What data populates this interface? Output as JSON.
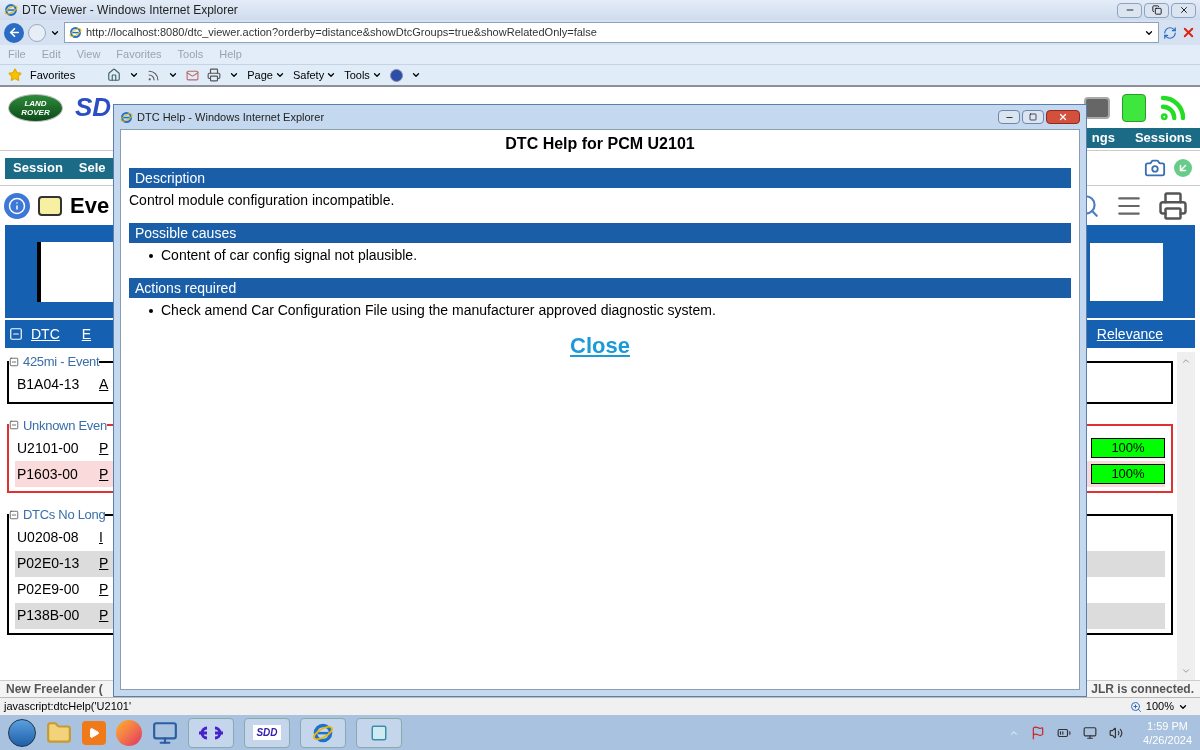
{
  "browser": {
    "title": "DTC Viewer - Windows Internet Explorer",
    "address": "http://localhost:8080/dtc_viewer.action?orderby=distance&showDtcGroups=true&showRelatedOnly=false",
    "menu": [
      "File",
      "Edit",
      "View",
      "Favorites",
      "Tools",
      "Help"
    ],
    "favorites": "Favorites",
    "commands": [
      "Page",
      "Safety",
      "Tools"
    ],
    "status_text": "javascript:dtcHelp('U2101'",
    "zoom": "100%"
  },
  "app": {
    "logo": [
      "LAND",
      "ROVER"
    ],
    "brand": "SD",
    "nav_left": [
      "Session",
      "Sele"
    ],
    "nav_right": [
      "ngs",
      "Sessions"
    ],
    "page_title": "Eve",
    "columns_left": [
      "DTC",
      "E"
    ],
    "column_right": "Relevance",
    "groups": [
      {
        "title": "425mi - Event",
        "alert": false,
        "rows": [
          {
            "code": "B1A04-13",
            "col2": "A",
            "kind": "plain"
          }
        ]
      },
      {
        "title": "Unknown Even",
        "alert": true,
        "rows": [
          {
            "code": "U2101-00",
            "col2": "P",
            "kind": "plain",
            "relevance": "100%"
          },
          {
            "code": "P1603-00",
            "col2": "P",
            "kind": "pink",
            "relevance": "100%"
          }
        ]
      },
      {
        "title": "DTCs No Long",
        "alert": false,
        "rows": [
          {
            "code": "U0208-08",
            "col2": "I",
            "kind": "plain"
          },
          {
            "code": "P02E0-13",
            "col2": "P",
            "kind": "grey"
          },
          {
            "code": "P02E9-00",
            "col2": "P",
            "kind": "plain"
          },
          {
            "code": "P138B-00",
            "col2": "P",
            "kind": "grey"
          }
        ]
      }
    ],
    "footer_left": "New Freelander (",
    "footer_right": "JLR is connected."
  },
  "dialog": {
    "title": "DTC Help - Windows Internet Explorer",
    "heading": "DTC Help for PCM U2101",
    "sections": [
      {
        "title": "Description",
        "kind": "text",
        "items": [
          "Control module configuration incompatible."
        ]
      },
      {
        "title": "Possible causes",
        "kind": "list",
        "items": [
          "Content of car config signal not plausible."
        ]
      },
      {
        "title": "Actions required",
        "kind": "list",
        "items": [
          "Check amend Car Configuration File using the manufacturer approved diagnostic system."
        ]
      }
    ],
    "close": "Close"
  },
  "taskbar": {
    "sdd_label": "SDD",
    "time": "1:59 PM",
    "date": "4/26/2024"
  }
}
